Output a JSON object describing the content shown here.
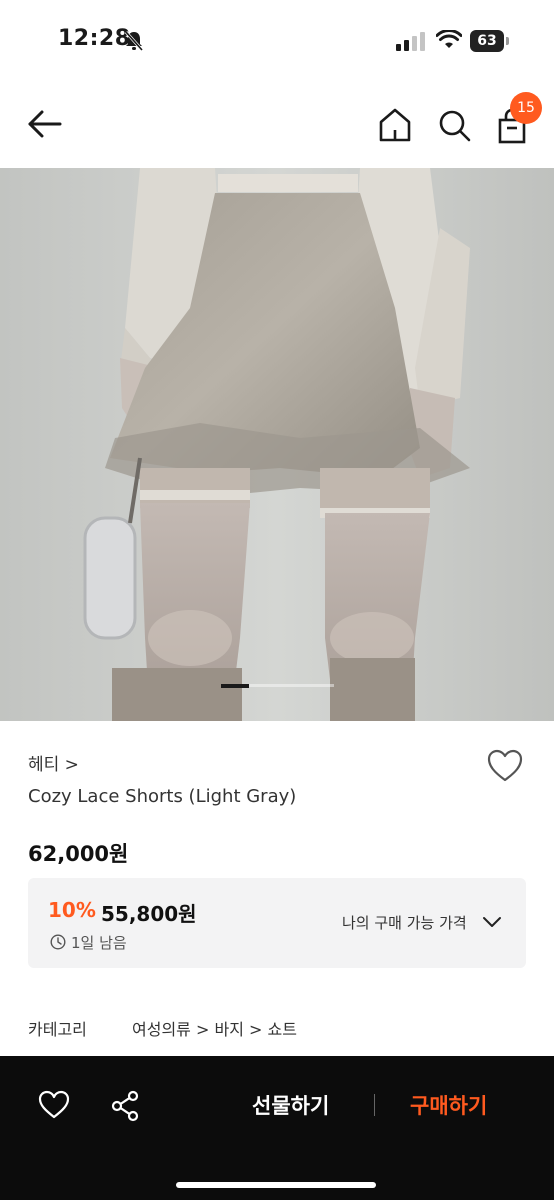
{
  "status_bar": {
    "time": "12:28",
    "battery": "63"
  },
  "header": {
    "cart_count": "15"
  },
  "product": {
    "brand": "헤티 >",
    "name": "Cozy Lace Shorts (Light Gray)",
    "price": "62,000원",
    "discount_rate": "10%",
    "discount_price": "55,800원",
    "time_remaining": "1일 남음",
    "my_price_label": "나의 구매 가능 가격",
    "category_label": "카테고리",
    "category_path": [
      "여성의류",
      "바지",
      "쇼트"
    ],
    "category_separator": ">"
  },
  "carousel": {
    "active_index": 0
  },
  "bottom_bar": {
    "gift_label": "선물하기",
    "buy_label": "구매하기"
  },
  "colors": {
    "accent": "#ff5a1f",
    "bottom_bar_bg": "#0c0c0c",
    "info_box_bg": "#f3f3f4"
  }
}
